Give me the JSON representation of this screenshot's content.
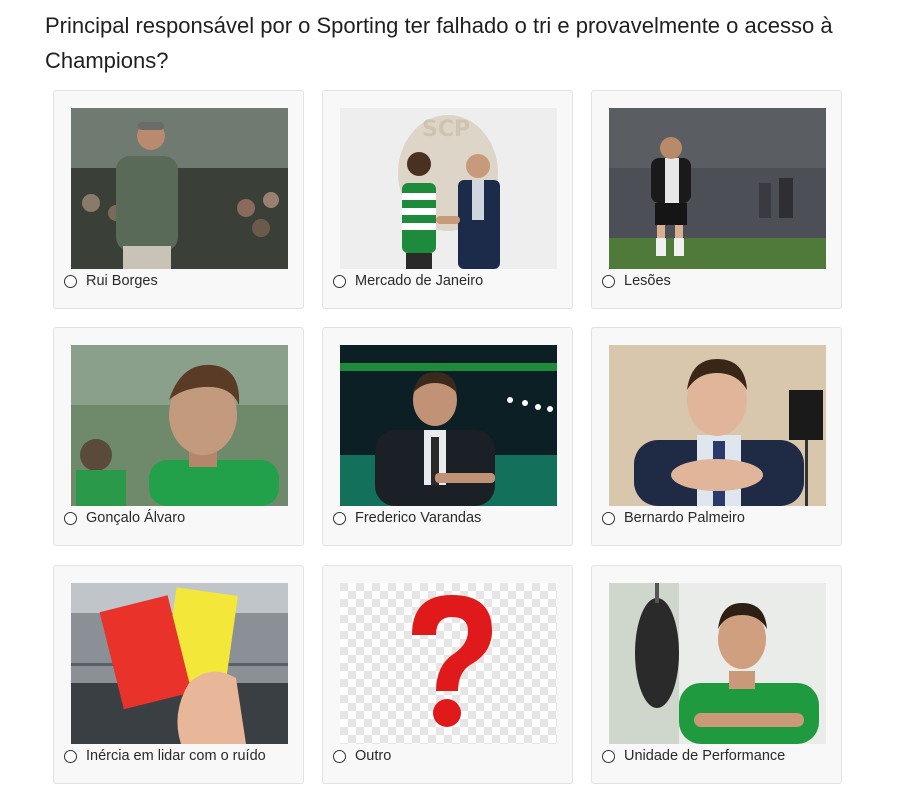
{
  "poll": {
    "question": "Principal responsável por o Sporting ter falhado o tri e provavelmente o acesso à Champions?",
    "options": [
      {
        "label": "Rui Borges",
        "image": "coach-sideline-photo"
      },
      {
        "label": "Mercado de Janeiro",
        "image": "signing-handshake-photo"
      },
      {
        "label": "Lesões",
        "image": "injured-player-photo"
      },
      {
        "label": "Gonçalo Álvaro",
        "image": "staff-portrait-photo"
      },
      {
        "label": "Frederico Varandas",
        "image": "president-interview-photo"
      },
      {
        "label": "Bernardo Palmeiro",
        "image": "executive-portrait-photo"
      },
      {
        "label": "Inércia em lidar com o ruído",
        "image": "red-yellow-card-photo"
      },
      {
        "label": "Outro",
        "image": "question-mark-icon"
      },
      {
        "label": "Unidade de Performance",
        "image": "fitness-coach-photo"
      }
    ]
  },
  "colors": {
    "sporting_green": "#1e8a3c",
    "question_red": "#e01a1a",
    "card_bg": "#f8f8f8",
    "card_border": "#e2e2e2"
  }
}
